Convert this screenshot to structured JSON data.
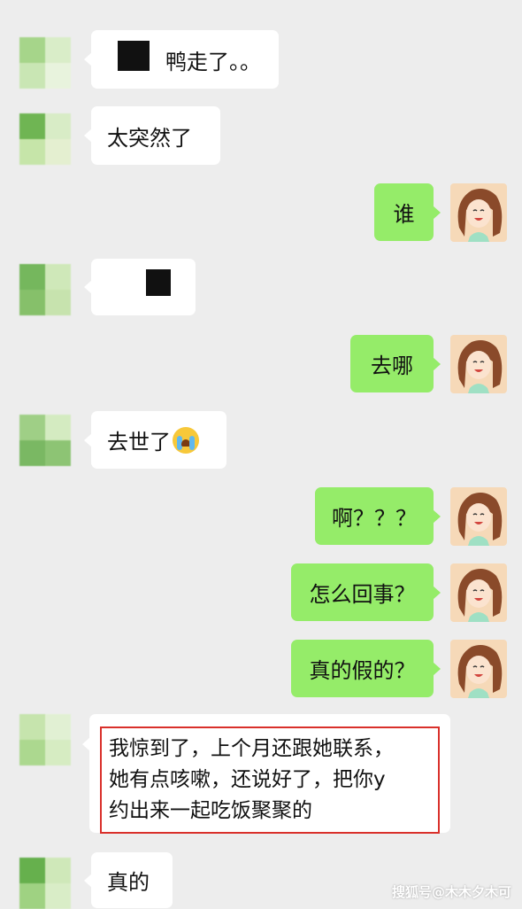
{
  "messages": [
    {
      "side": "in",
      "text": "鸭走了。。",
      "redacted": true
    },
    {
      "side": "in",
      "text": "太突然了"
    },
    {
      "side": "out",
      "text": "谁"
    },
    {
      "side": "in",
      "text": "",
      "redacted": true
    },
    {
      "side": "out",
      "text": "去哪"
    },
    {
      "side": "in",
      "text": "去世了",
      "emoji": "crying-face-icon"
    },
    {
      "side": "out",
      "text": "啊？？？"
    },
    {
      "side": "out",
      "text": "怎么回事？"
    },
    {
      "side": "out",
      "text": "真的假的？"
    },
    {
      "side": "in",
      "lines": [
        "我惊到了，上个月还跟她联系，",
        "她有点咳嗽，还说好了，把你y",
        "约出来一起吃饭聚聚的"
      ],
      "highlighted": true
    },
    {
      "side": "in",
      "text": "真的"
    }
  ],
  "watermark": "搜狐号@木木夕木可",
  "colors": {
    "background": "#ededed",
    "incoming_bubble": "#ffffff",
    "outgoing_bubble": "#95ec69",
    "highlight_border": "#d9302b"
  }
}
